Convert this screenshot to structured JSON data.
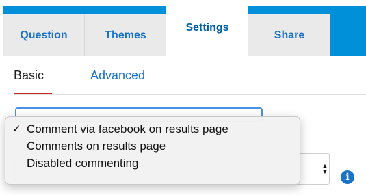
{
  "tabs": [
    {
      "label": "Question",
      "active": false
    },
    {
      "label": "Themes",
      "active": false
    },
    {
      "label": "Settings",
      "active": true
    },
    {
      "label": "Share",
      "active": false
    }
  ],
  "subtabs": [
    {
      "label": "Basic",
      "active": true
    },
    {
      "label": "Advanced",
      "active": false
    }
  ],
  "dropdown": {
    "options": [
      {
        "label": "Comment via facebook on results page",
        "selected": true
      },
      {
        "label": "Comments on results page",
        "selected": false
      },
      {
        "label": "Disabled commenting",
        "selected": false
      }
    ]
  },
  "icons": {
    "check": "checkmark-icon",
    "stepper": "select-stepper-icon",
    "info": "info-icon"
  },
  "colors": {
    "accent": "#0090d9",
    "link": "#1a73c6",
    "active_underline": "#c62828"
  }
}
